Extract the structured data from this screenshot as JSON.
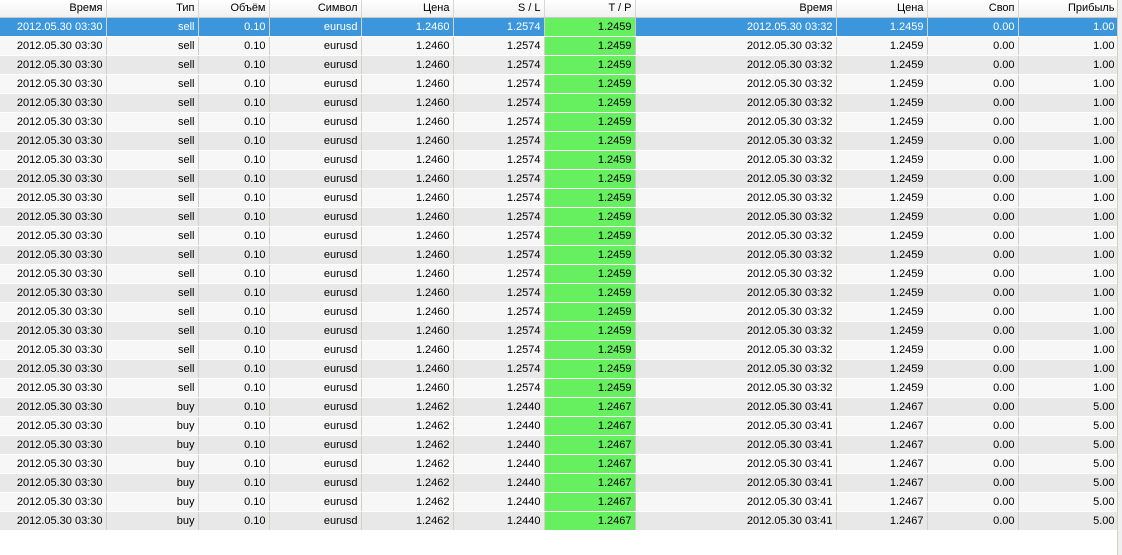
{
  "table": {
    "columns": [
      "Время",
      "Тип",
      "Объём",
      "Символ",
      "Цена",
      "S / L",
      "T / P",
      "Время",
      "Цена",
      "Своп",
      "Прибыль"
    ],
    "rows": [
      [
        "2012.05.30 03:30",
        "sell",
        "0.10",
        "eurusd",
        "1.2460",
        "1.2574",
        "1.2459",
        "2012.05.30 03:32",
        "1.2459",
        "0.00",
        "1.00"
      ],
      [
        "2012.05.30 03:30",
        "sell",
        "0.10",
        "eurusd",
        "1.2460",
        "1.2574",
        "1.2459",
        "2012.05.30 03:32",
        "1.2459",
        "0.00",
        "1.00"
      ],
      [
        "2012.05.30 03:30",
        "sell",
        "0.10",
        "eurusd",
        "1.2460",
        "1.2574",
        "1.2459",
        "2012.05.30 03:32",
        "1.2459",
        "0.00",
        "1.00"
      ],
      [
        "2012.05.30 03:30",
        "sell",
        "0.10",
        "eurusd",
        "1.2460",
        "1.2574",
        "1.2459",
        "2012.05.30 03:32",
        "1.2459",
        "0.00",
        "1.00"
      ],
      [
        "2012.05.30 03:30",
        "sell",
        "0.10",
        "eurusd",
        "1.2460",
        "1.2574",
        "1.2459",
        "2012.05.30 03:32",
        "1.2459",
        "0.00",
        "1.00"
      ],
      [
        "2012.05.30 03:30",
        "sell",
        "0.10",
        "eurusd",
        "1.2460",
        "1.2574",
        "1.2459",
        "2012.05.30 03:32",
        "1.2459",
        "0.00",
        "1.00"
      ],
      [
        "2012.05.30 03:30",
        "sell",
        "0.10",
        "eurusd",
        "1.2460",
        "1.2574",
        "1.2459",
        "2012.05.30 03:32",
        "1.2459",
        "0.00",
        "1.00"
      ],
      [
        "2012.05.30 03:30",
        "sell",
        "0.10",
        "eurusd",
        "1.2460",
        "1.2574",
        "1.2459",
        "2012.05.30 03:32",
        "1.2459",
        "0.00",
        "1.00"
      ],
      [
        "2012.05.30 03:30",
        "sell",
        "0.10",
        "eurusd",
        "1.2460",
        "1.2574",
        "1.2459",
        "2012.05.30 03:32",
        "1.2459",
        "0.00",
        "1.00"
      ],
      [
        "2012.05.30 03:30",
        "sell",
        "0.10",
        "eurusd",
        "1.2460",
        "1.2574",
        "1.2459",
        "2012.05.30 03:32",
        "1.2459",
        "0.00",
        "1.00"
      ],
      [
        "2012.05.30 03:30",
        "sell",
        "0.10",
        "eurusd",
        "1.2460",
        "1.2574",
        "1.2459",
        "2012.05.30 03:32",
        "1.2459",
        "0.00",
        "1.00"
      ],
      [
        "2012.05.30 03:30",
        "sell",
        "0.10",
        "eurusd",
        "1.2460",
        "1.2574",
        "1.2459",
        "2012.05.30 03:32",
        "1.2459",
        "0.00",
        "1.00"
      ],
      [
        "2012.05.30 03:30",
        "sell",
        "0.10",
        "eurusd",
        "1.2460",
        "1.2574",
        "1.2459",
        "2012.05.30 03:32",
        "1.2459",
        "0.00",
        "1.00"
      ],
      [
        "2012.05.30 03:30",
        "sell",
        "0.10",
        "eurusd",
        "1.2460",
        "1.2574",
        "1.2459",
        "2012.05.30 03:32",
        "1.2459",
        "0.00",
        "1.00"
      ],
      [
        "2012.05.30 03:30",
        "sell",
        "0.10",
        "eurusd",
        "1.2460",
        "1.2574",
        "1.2459",
        "2012.05.30 03:32",
        "1.2459",
        "0.00",
        "1.00"
      ],
      [
        "2012.05.30 03:30",
        "sell",
        "0.10",
        "eurusd",
        "1.2460",
        "1.2574",
        "1.2459",
        "2012.05.30 03:32",
        "1.2459",
        "0.00",
        "1.00"
      ],
      [
        "2012.05.30 03:30",
        "sell",
        "0.10",
        "eurusd",
        "1.2460",
        "1.2574",
        "1.2459",
        "2012.05.30 03:32",
        "1.2459",
        "0.00",
        "1.00"
      ],
      [
        "2012.05.30 03:30",
        "sell",
        "0.10",
        "eurusd",
        "1.2460",
        "1.2574",
        "1.2459",
        "2012.05.30 03:32",
        "1.2459",
        "0.00",
        "1.00"
      ],
      [
        "2012.05.30 03:30",
        "sell",
        "0.10",
        "eurusd",
        "1.2460",
        "1.2574",
        "1.2459",
        "2012.05.30 03:32",
        "1.2459",
        "0.00",
        "1.00"
      ],
      [
        "2012.05.30 03:30",
        "sell",
        "0.10",
        "eurusd",
        "1.2460",
        "1.2574",
        "1.2459",
        "2012.05.30 03:32",
        "1.2459",
        "0.00",
        "1.00"
      ],
      [
        "2012.05.30 03:30",
        "buy",
        "0.10",
        "eurusd",
        "1.2462",
        "1.2440",
        "1.2467",
        "2012.05.30 03:41",
        "1.2467",
        "0.00",
        "5.00"
      ],
      [
        "2012.05.30 03:30",
        "buy",
        "0.10",
        "eurusd",
        "1.2462",
        "1.2440",
        "1.2467",
        "2012.05.30 03:41",
        "1.2467",
        "0.00",
        "5.00"
      ],
      [
        "2012.05.30 03:30",
        "buy",
        "0.10",
        "eurusd",
        "1.2462",
        "1.2440",
        "1.2467",
        "2012.05.30 03:41",
        "1.2467",
        "0.00",
        "5.00"
      ],
      [
        "2012.05.30 03:30",
        "buy",
        "0.10",
        "eurusd",
        "1.2462",
        "1.2440",
        "1.2467",
        "2012.05.30 03:41",
        "1.2467",
        "0.00",
        "5.00"
      ],
      [
        "2012.05.30 03:30",
        "buy",
        "0.10",
        "eurusd",
        "1.2462",
        "1.2440",
        "1.2467",
        "2012.05.30 03:41",
        "1.2467",
        "0.00",
        "5.00"
      ],
      [
        "2012.05.30 03:30",
        "buy",
        "0.10",
        "eurusd",
        "1.2462",
        "1.2440",
        "1.2467",
        "2012.05.30 03:41",
        "1.2467",
        "0.00",
        "5.00"
      ],
      [
        "2012.05.30 03:30",
        "buy",
        "0.10",
        "eurusd",
        "1.2462",
        "1.2440",
        "1.2467",
        "2012.05.30 03:41",
        "1.2467",
        "0.00",
        "5.00"
      ]
    ],
    "selected_row": 0
  },
  "colors": {
    "selection": "#3c96dc",
    "tp_highlight": "#66ef5f",
    "row_odd": "#e8e8e8",
    "row_even": "#f7f7f7"
  }
}
